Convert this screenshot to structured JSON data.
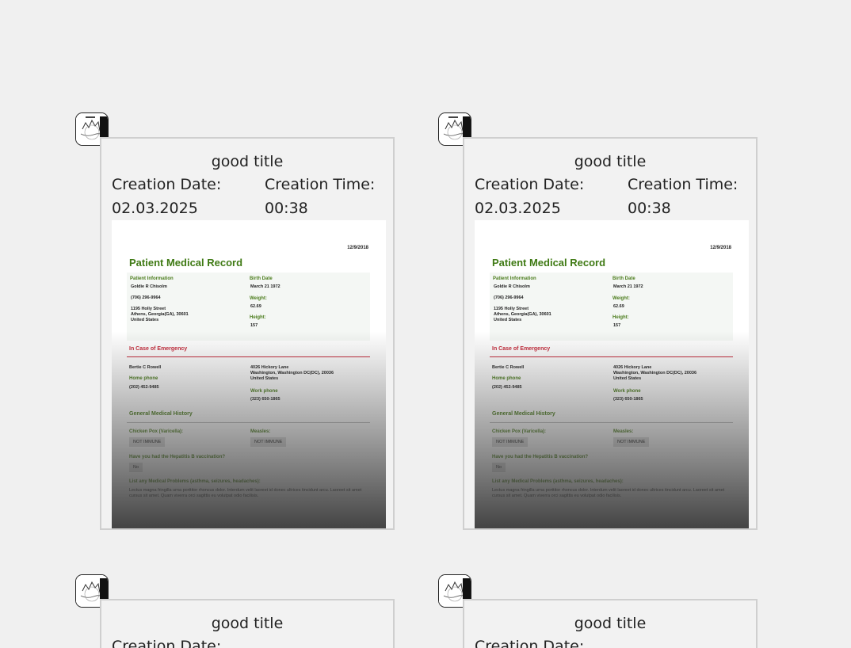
{
  "cards": [
    {
      "title": "good title",
      "creation_date_label": "Creation Date:",
      "creation_date": "02.03.2025",
      "creation_time_label": "Creation Time:",
      "creation_time": "00:38"
    },
    {
      "title": "good title",
      "creation_date_label": "Creation Date:",
      "creation_date": "02.03.2025",
      "creation_time_label": "Creation Time:",
      "creation_time": "00:38"
    },
    {
      "title": "good title",
      "creation_date_label": "Creation Date:"
    },
    {
      "title": "good title",
      "creation_date_label": "Creation Date:"
    }
  ],
  "document": {
    "date": "12/9/2018",
    "title": "Patient Medical Record",
    "patient_info_label": "Patient Information",
    "patient_name": "Goldie R Chisolm",
    "patient_phone": "(706) 296-9964",
    "patient_address_1": "1195 Holly Street",
    "patient_address_2": "Athens, Georgia(GA), 30601",
    "patient_address_3": "United States",
    "birth_date_label": "Birth Date",
    "birth_date": "March 21 1972",
    "weight_label": "Weight:",
    "weight": "62.69",
    "height_label": "Height:",
    "height": "157",
    "emergency_title": "In Case of Emergency",
    "emergency_name": "Bertie C Rowell",
    "home_phone_label": "Home phone",
    "home_phone": "(202) 452-9485",
    "emergency_address_1": "4026 Hickory Lane",
    "emergency_address_2": "Washington, Washington DC(DC), 20036",
    "emergency_address_3": "United States",
    "work_phone_label": "Work phone",
    "work_phone": "(323) 650-1865",
    "history_title": "General Medical History",
    "chicken_pox_label": "Chicken Pox (Varicella):",
    "chicken_pox_value": "NOT IMMUNE",
    "measles_label": "Measles:",
    "measles_value": "NOT IMMUNE",
    "hepatitis_label": "Have you had the Hepatitis B vaccination?",
    "hepatitis_value": "No",
    "problems_label": "List any Medical Problems (asthma, seizures, headaches):",
    "problems_text": "Lectus magna fringilla urna porttitor rhoncus dolor. Interdum velit laoreet id donec ultrices tincidunt arcu. Laoreet sit amet cursus sit amet. Quam viverra orci sagittis eu volutpat odio facilisis."
  },
  "colors": {
    "page_background": "#f0f0f0",
    "card_border": "#cfcfcf",
    "doc_green": "#3f7a14",
    "emergency_red": "#c62839"
  }
}
